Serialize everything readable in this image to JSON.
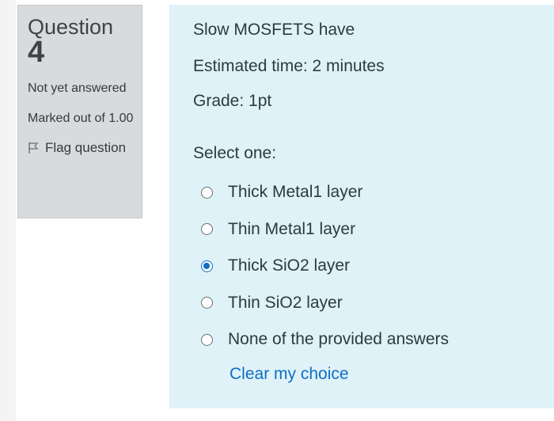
{
  "info": {
    "question_label": "Question",
    "question_number": "4",
    "state": "Not yet answered",
    "marked_out_of": "Marked out of 1.00",
    "flag_label": "Flag question"
  },
  "question": {
    "text": "Slow MOSFETS have",
    "estimated_time": "Estimated time: 2 minutes",
    "grade": "Grade: 1pt",
    "select_prompt": "Select one:",
    "options": [
      {
        "label": "Thick Metal1 layer",
        "selected": false
      },
      {
        "label": "Thin Metal1 layer",
        "selected": false
      },
      {
        "label": "Thick SiO2 layer",
        "selected": true
      },
      {
        "label": "Thin SiO2 layer",
        "selected": false
      },
      {
        "label": "None of the provided answers",
        "selected": false
      }
    ],
    "clear_label": "Clear my choice"
  },
  "colors": {
    "info_bg": "#d9dadc",
    "content_bg": "#def2f8",
    "accent": "#0f6fc5"
  }
}
